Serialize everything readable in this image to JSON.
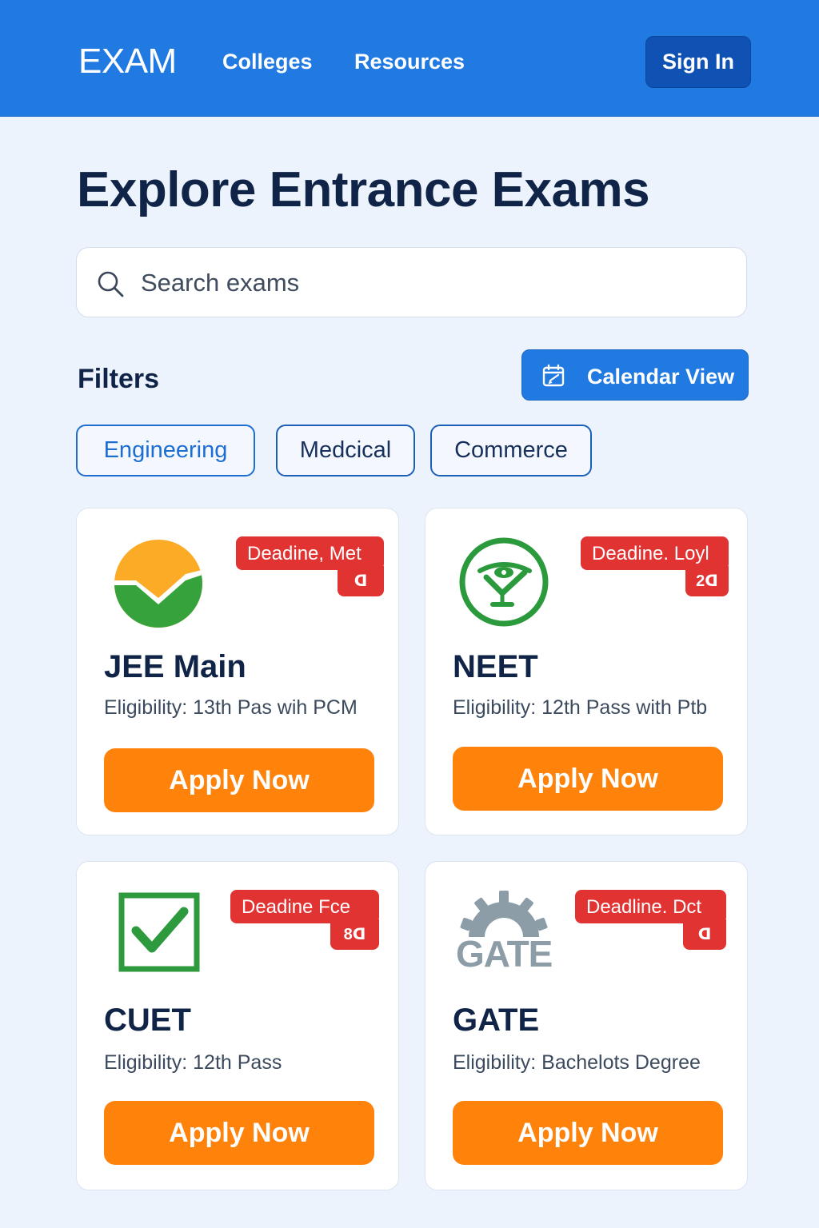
{
  "header": {
    "brand": "EXAM",
    "nav": [
      "Colleges",
      "Resources"
    ],
    "sign_in": "Sign In"
  },
  "main": {
    "title": "Explore Entrance Exams",
    "search": {
      "placeholder": "Search exams",
      "value": "",
      "icon": "search-icon"
    },
    "filters_label": "Filters",
    "calendar_button": {
      "label": "Calendar View",
      "icon": "calendar-icon"
    },
    "filter_chips": [
      "Engineering",
      "Medcical",
      "Commerce"
    ],
    "cards": [
      {
        "name": "JEE Main",
        "eligibility": "Eligibility: 13th Pas wih PCM",
        "deadline": "Deadine, Met",
        "deadline_sub": "ᗡ",
        "apply": "Apply Now",
        "logo": "orange-green-check-logo"
      },
      {
        "name": "NEET",
        "eligibility": "Eligibility: 12th Pass with Ptb",
        "deadline": "Deadine. Loyl",
        "deadline_sub": "2ᗡ",
        "apply": "Apply Now",
        "logo": "green-circle-emblem-logo"
      },
      {
        "name": "CUET",
        "eligibility": "Eligibility: 12th Pass",
        "deadline": "Deadine Fce",
        "deadline_sub": "8ᗡ",
        "apply": "Apply Now",
        "logo": "green-checkbox-logo"
      },
      {
        "name": "GATE",
        "eligibility": "Eligibility: Bachelots Degree",
        "deadline": "Deadline. Dct",
        "deadline_sub": "ᗡ",
        "apply": "Apply Now",
        "logo": "gate-gear-logo",
        "logo_text": "GATE"
      }
    ]
  },
  "colors": {
    "header_bg": "#2179e2",
    "sign_in_bg": "#0f52b4",
    "page_bg": "#edf3fd",
    "accent_orange": "#ff820b",
    "deadline_red": "#e23333",
    "title_navy": "#0f2447"
  }
}
